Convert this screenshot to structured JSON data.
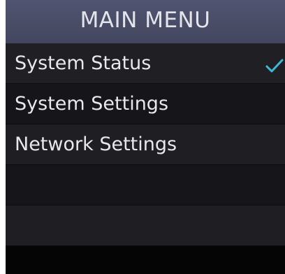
{
  "header": {
    "title": "MAIN MENU"
  },
  "menu": {
    "items": [
      {
        "label": "System Status",
        "selected": true
      },
      {
        "label": "System Settings",
        "selected": false
      },
      {
        "label": "Network Settings",
        "selected": false
      },
      {
        "label": "",
        "selected": false
      },
      {
        "label": "",
        "selected": false
      }
    ]
  },
  "icons": {
    "selected_marker": "checkmark-icon"
  },
  "colors": {
    "accent": "#3fb8d8",
    "header_bg": "#4a4e68",
    "text": "#e8e8ea"
  }
}
